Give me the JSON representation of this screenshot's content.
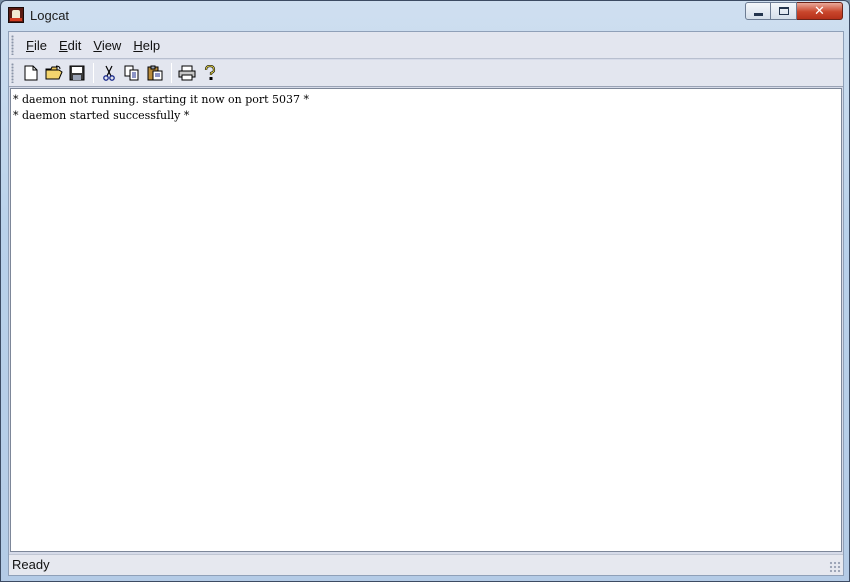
{
  "window": {
    "title": "Logcat",
    "buttons": {
      "minimize": "minimize",
      "maximize": "maximize",
      "close": "close"
    }
  },
  "menu": {
    "items": [
      {
        "accel": "F",
        "rest": "ile"
      },
      {
        "accel": "E",
        "rest": "dit"
      },
      {
        "accel": "V",
        "rest": "iew"
      },
      {
        "accel": "H",
        "rest": "elp"
      }
    ]
  },
  "toolbar": {
    "buttons": [
      "new-file-icon",
      "open-folder-icon",
      "save-icon",
      "cut-icon",
      "copy-icon",
      "paste-icon",
      "print-icon",
      "help-icon"
    ]
  },
  "log": {
    "lines": [
      "* daemon not running. starting it now on port 5037 *",
      "* daemon started successfully *"
    ]
  },
  "status": {
    "text": "Ready"
  }
}
